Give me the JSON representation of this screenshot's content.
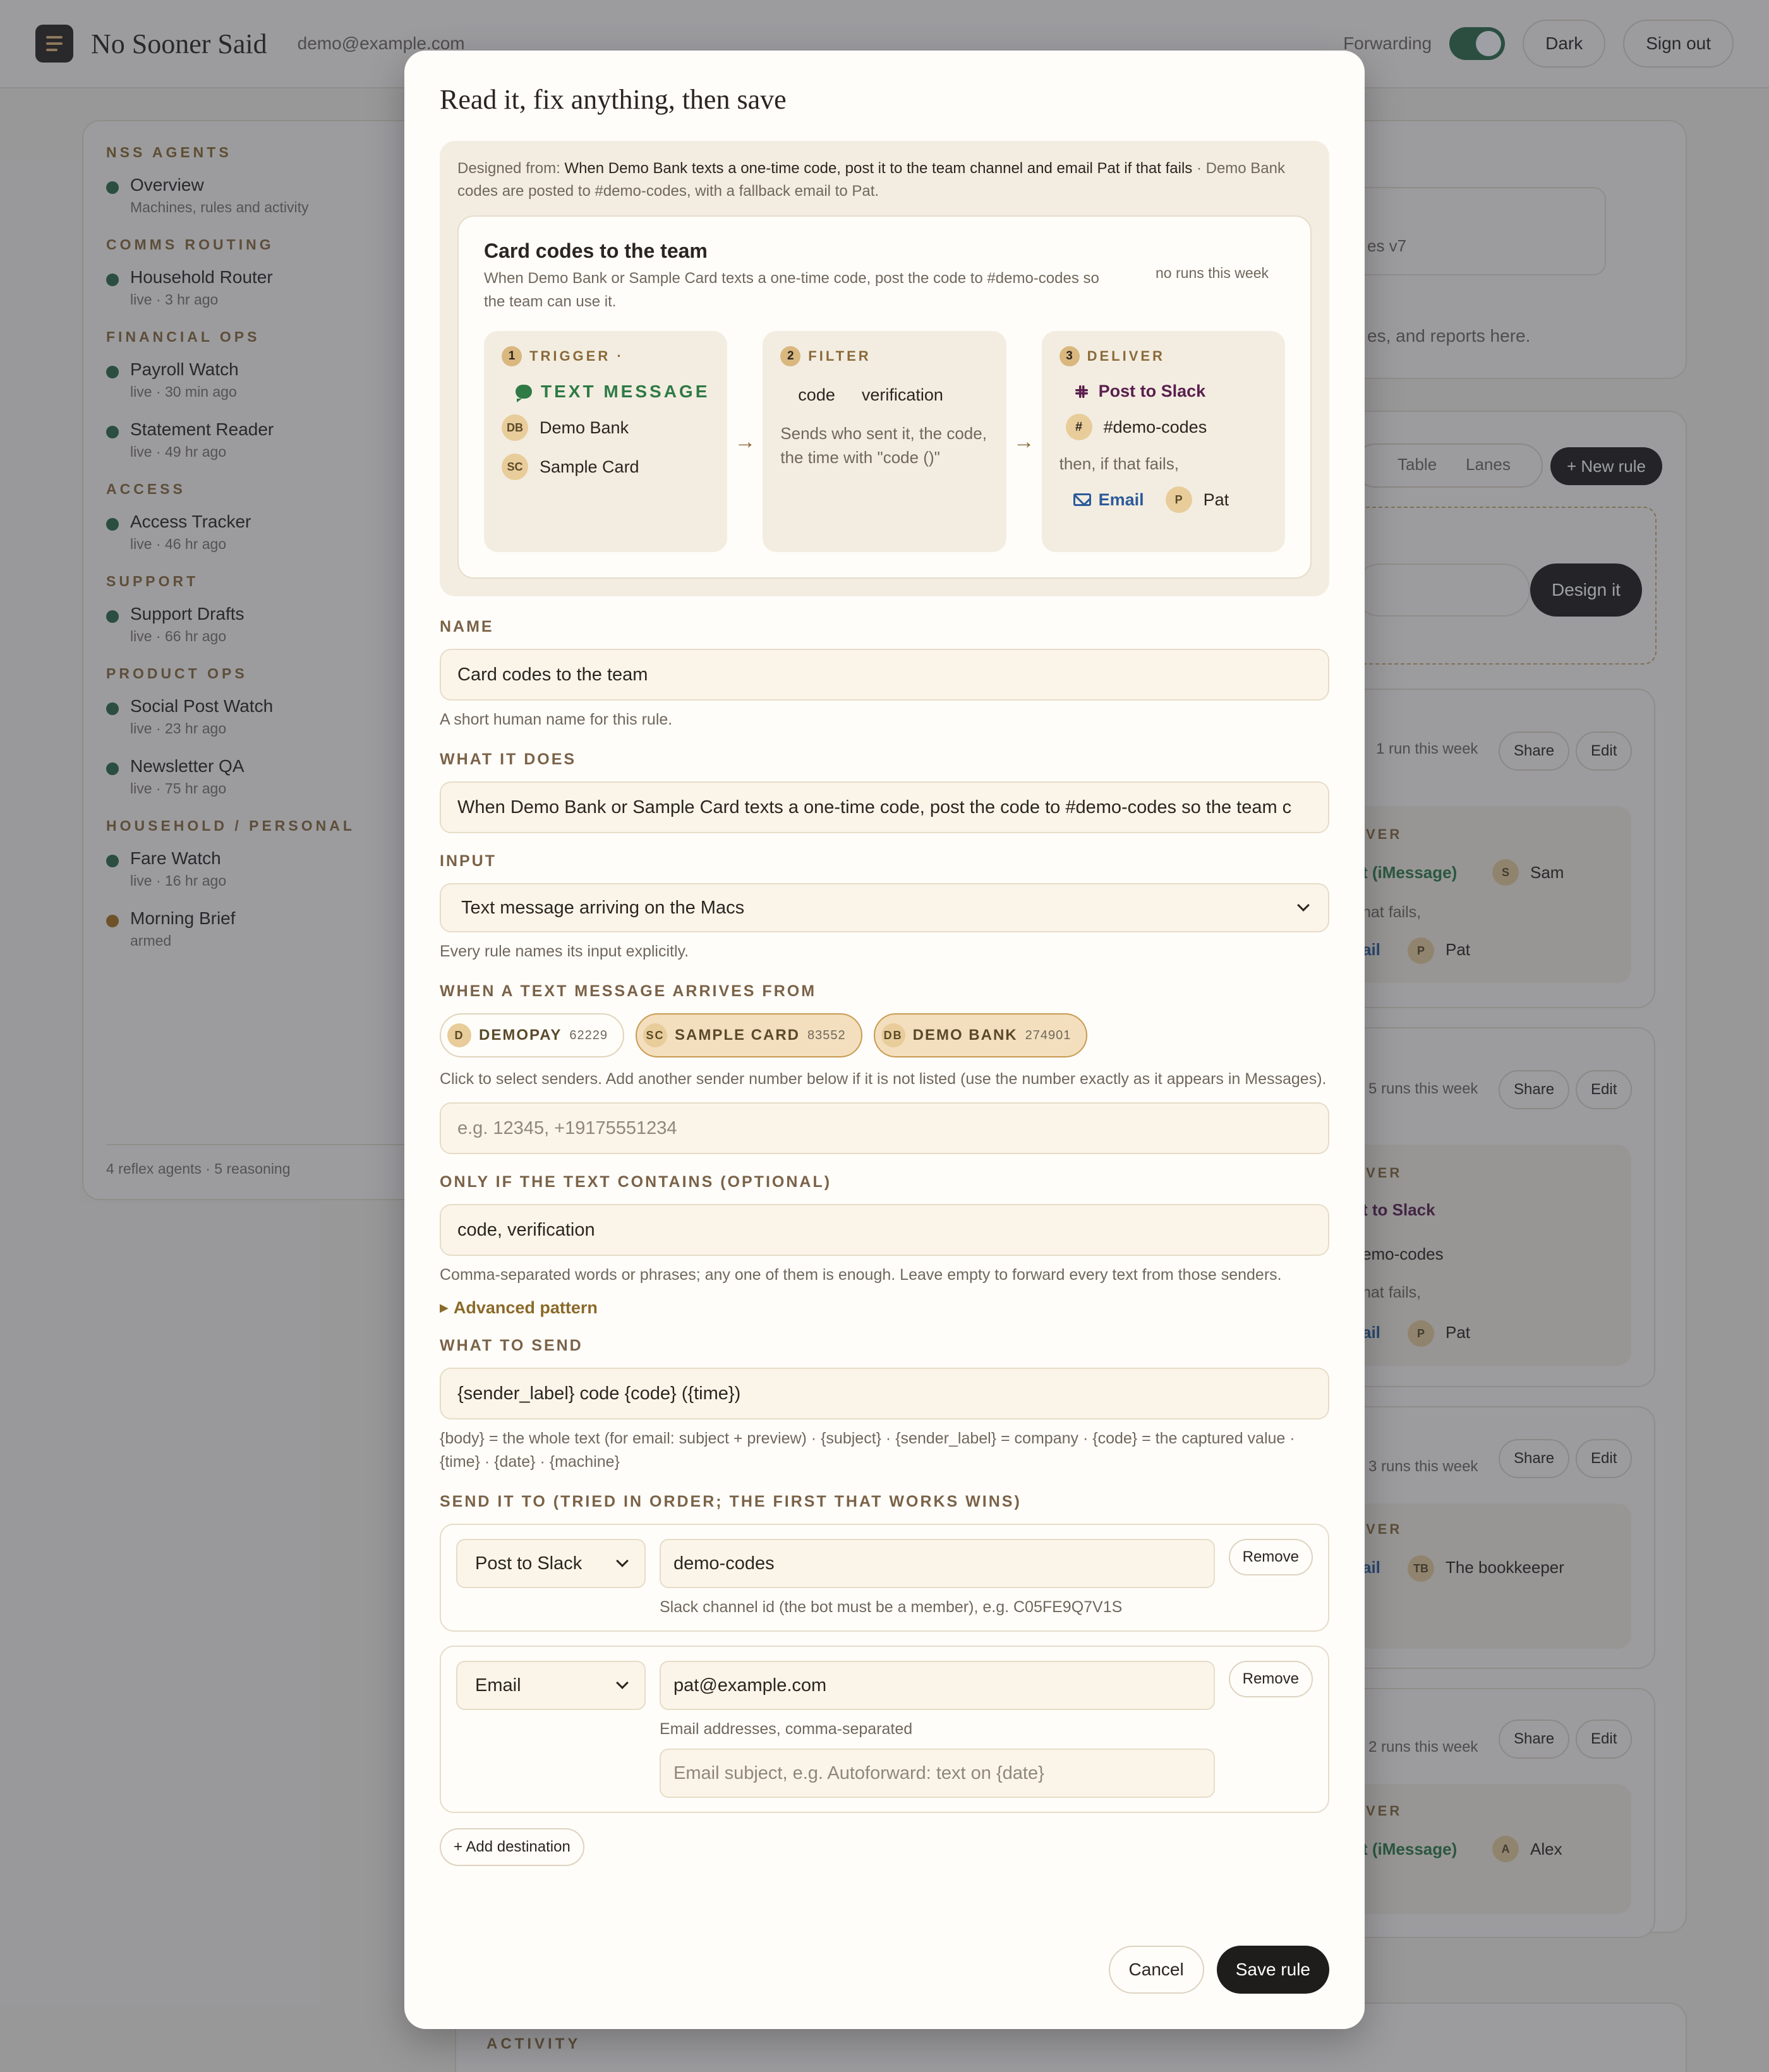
{
  "app": {
    "brand": "No Sooner Said",
    "user_email": "demo@example.com"
  },
  "topbar": {
    "forwarding_label": "Forwarding",
    "dark_label": "Dark",
    "signout_label": "Sign out"
  },
  "sidebar": {
    "sections": [
      {
        "title": "NSS AGENTS",
        "items": [
          {
            "name": "Overview",
            "sub": "Machines, rules and activity",
            "status": "live"
          }
        ]
      },
      {
        "title": "COMMS ROUTING",
        "items": [
          {
            "name": "Household Router",
            "sub": "live · 3 hr ago",
            "status": "live"
          }
        ]
      },
      {
        "title": "FINANCIAL OPS",
        "items": [
          {
            "name": "Payroll Watch",
            "sub": "live · 30 min ago",
            "status": "live"
          },
          {
            "name": "Statement Reader",
            "sub": "live · 49 hr ago",
            "status": "live"
          }
        ]
      },
      {
        "title": "ACCESS",
        "items": [
          {
            "name": "Access Tracker",
            "sub": "live · 46 hr ago",
            "status": "live"
          }
        ]
      },
      {
        "title": "SUPPORT",
        "items": [
          {
            "name": "Support Drafts",
            "sub": "live · 66 hr ago",
            "status": "live"
          }
        ]
      },
      {
        "title": "PRODUCT OPS",
        "items": [
          {
            "name": "Social Post Watch",
            "sub": "live · 23 hr ago",
            "status": "live"
          },
          {
            "name": "Newsletter QA",
            "sub": "live · 75 hr ago",
            "status": "live"
          }
        ]
      },
      {
        "title": "HOUSEHOLD / PERSONAL",
        "items": [
          {
            "name": "Fare Watch",
            "sub": "live · 16 hr ago",
            "status": "live"
          },
          {
            "name": "Morning Brief",
            "sub": "armed",
            "status": "armed"
          }
        ]
      }
    ],
    "footer": "4 reflex agents · 5 reasoning"
  },
  "modal": {
    "title": "Read it, fix anything, then save",
    "designed_prefix": "Designed from:",
    "designed_prompt": "When Demo Bank texts a one-time code, post it to the team channel and email Pat if that fails",
    "designed_suffix": "· Demo Bank codes are posted to #demo-codes, with a fallback email to Pat.",
    "card": {
      "title": "Card codes to the team",
      "description": "When Demo Bank or Sample Card texts a one-time code, post the code to #demo-codes so the team can use it.",
      "runs": "no runs this week",
      "trigger": {
        "num": "1",
        "label": "TRIGGER ·",
        "type": "TEXT MESSAGE",
        "senders": [
          {
            "initials": "DB",
            "name": "Demo Bank"
          },
          {
            "initials": "SC",
            "name": "Sample Card"
          }
        ]
      },
      "filter": {
        "num": "2",
        "label": "FILTER",
        "keywords": [
          "code",
          "verification"
        ],
        "desc": "Sends who sent it, the code, the time with \"code ()\""
      },
      "deliver": {
        "num": "3",
        "label": "DELIVER",
        "primary": "Post to Slack",
        "channel_icon": "#",
        "channel": "#demo-codes",
        "fallback_text": "then, if that fails,",
        "fallback": "Email",
        "person_initial": "P",
        "person": "Pat"
      }
    },
    "name": {
      "label": "NAME",
      "value": "Card codes to the team",
      "help": "A short human name for this rule."
    },
    "what": {
      "label": "WHAT IT DOES",
      "value": "When Demo Bank or Sample Card texts a one-time code, post the code to #demo-codes so the team c"
    },
    "input": {
      "label": "INPUT",
      "value": "Text message arriving on the Macs",
      "help": "Every rule names its input explicitly."
    },
    "from": {
      "label": "WHEN A TEXT MESSAGE ARRIVES FROM",
      "senders": [
        {
          "initials": "D",
          "name": "DEMOPAY",
          "number": "62229",
          "selected": false
        },
        {
          "initials": "SC",
          "name": "SAMPLE CARD",
          "number": "83552",
          "selected": true
        },
        {
          "initials": "DB",
          "name": "DEMO BANK",
          "number": "274901",
          "selected": true
        }
      ],
      "help": "Click to select senders. Add another sender number below if it is not listed (use the number exactly as it appears in Messages).",
      "placeholder": "e.g. 12345, +19175551234"
    },
    "contains": {
      "label": "ONLY IF THE TEXT CONTAINS (OPTIONAL)",
      "value": "code, verification",
      "help": "Comma-separated words or phrases; any one of them is enough. Leave empty to forward every text from those senders.",
      "advanced": "Advanced pattern"
    },
    "send": {
      "label": "WHAT TO SEND",
      "value": "{sender_label} code {code} ({time})",
      "help": "{body} = the whole text (for email: subject + preview) · {subject} · {sender_label} = company · {code} = the captured value · {time} · {date} · {machine}"
    },
    "dest": {
      "label": "SEND IT TO (TRIED IN ORDER; THE FIRST THAT WORKS WINS)",
      "items": [
        {
          "type": "Post to Slack",
          "value": "demo-codes",
          "help": "Slack channel id (the bot must be a member), e.g. C05FE9Q7V1S",
          "remove": "Remove"
        },
        {
          "type": "Email",
          "value": "pat@example.com",
          "help": "Email addresses, comma-separated",
          "subject_placeholder": "Email subject, e.g. Autoforward: text on {date}",
          "remove": "Remove"
        }
      ],
      "add": "+ Add destination"
    },
    "cancel": "Cancel",
    "save": "Save rule"
  },
  "background": {
    "version": "es v7",
    "reports": "es, and reports here.",
    "view_table": "Table",
    "view_lanes": "Lanes",
    "new_rule": "+ New rule",
    "design_it": "Design it",
    "share": "Share",
    "edit": "Edit",
    "deliver": "VER",
    "fails": "hat fails,",
    "email_fragment": "ail",
    "imessage_fragment": "t (iMessage)",
    "slack_fragment": "t to Slack",
    "channel_fragment": "emo-codes",
    "runs": [
      "1 run this week",
      "5 runs this week",
      "3 runs this week",
      "2 runs this week"
    ],
    "people": [
      {
        "initial": "S",
        "name": "Sam"
      },
      {
        "initial": "P",
        "name": "Pat"
      },
      {
        "initial": "TB",
        "name": "The bookkeeper"
      },
      {
        "initial": "A",
        "name": "Alex"
      }
    ],
    "activity": "ACTIVITY"
  }
}
